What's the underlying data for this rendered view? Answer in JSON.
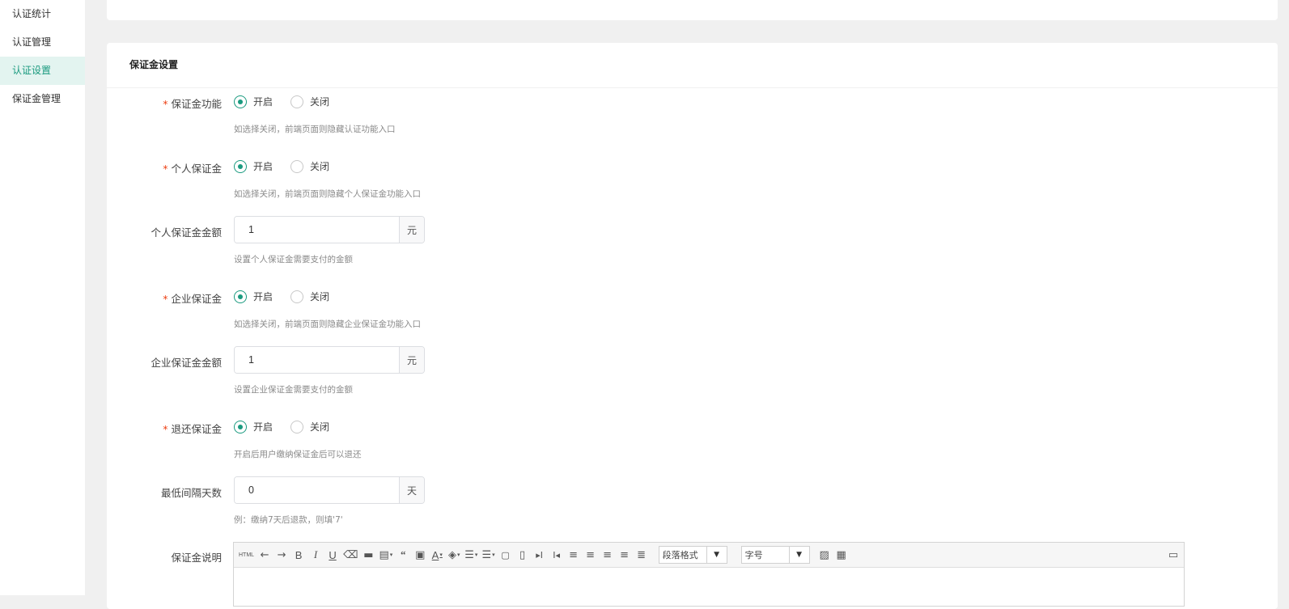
{
  "sidebar": {
    "items": [
      {
        "label": "认证统计"
      },
      {
        "label": "认证管理"
      },
      {
        "label": "认证设置"
      },
      {
        "label": "保证金管理"
      }
    ],
    "active_index": 2
  },
  "section": {
    "title": "保证金设置"
  },
  "options": {
    "on": "开启",
    "off": "关闭"
  },
  "form": {
    "deposit_feature": {
      "label": "保证金功能",
      "required": true,
      "value": "开启",
      "hint": "如选择关闭，前端页面则隐藏认证功能入口"
    },
    "personal_deposit": {
      "label": "个人保证金",
      "required": true,
      "value": "开启",
      "hint": "如选择关闭，前端页面则隐藏个人保证金功能入口"
    },
    "personal_amount": {
      "label": "个人保证金金额",
      "value": "1",
      "unit": "元",
      "hint": "设置个人保证金需要支付的金额"
    },
    "company_deposit": {
      "label": "企业保证金",
      "required": true,
      "value": "开启",
      "hint": "如选择关闭，前端页面则隐藏企业保证金功能入口"
    },
    "company_amount": {
      "label": "企业保证金金额",
      "value": "1",
      "unit": "元",
      "hint": "设置企业保证金需要支付的金额"
    },
    "refund_deposit": {
      "label": "退还保证金",
      "required": true,
      "value": "开启",
      "hint": "开启后用户缴纳保证金后可以退还"
    },
    "min_interval_days": {
      "label": "最低间隔天数",
      "value": "0",
      "unit": "天",
      "hint": "例：缴纳7天后退款，则填'7'"
    },
    "description": {
      "label": "保证金说明"
    }
  },
  "editor": {
    "html_label": "HTML",
    "paragraph_format": "段落格式",
    "font_size": "字号"
  },
  "colors": {
    "accent": "#1a9a7f",
    "required": "#ed4014"
  }
}
